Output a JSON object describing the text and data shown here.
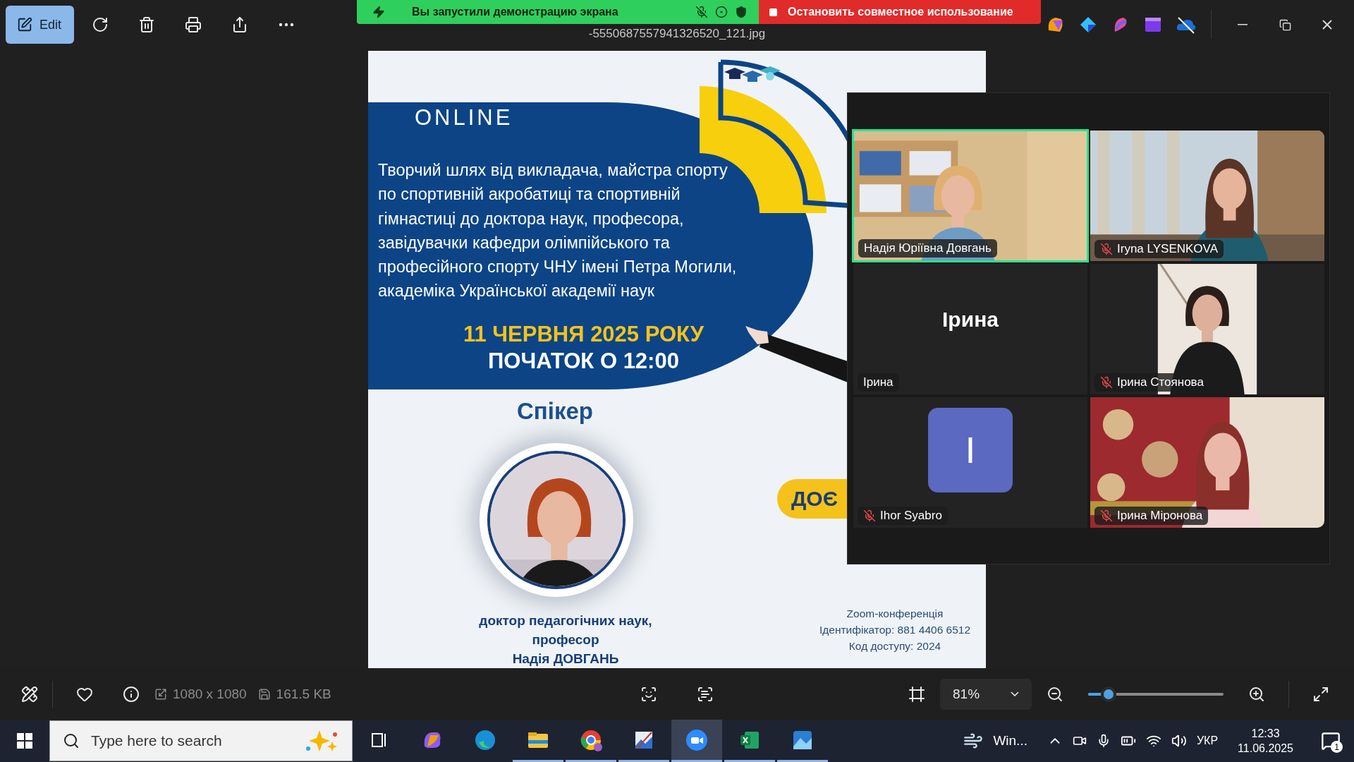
{
  "toolbar": {
    "edit_button": "Edit",
    "filename": "-5550687557941326520_121.jpg"
  },
  "share_banner": {
    "status": "Вы запустили демонстрацию экрана",
    "stop_button": "Остановить совместное использование"
  },
  "poster": {
    "badge": "ONLINE",
    "description": [
      "Творчий шлях від викладача, майстра спорту",
      "по спортивній акробатиці та спортивній",
      "гімнастиці до доктора наук, професора,",
      "завідувачки кафедри олімпійського та",
      "професійного спорту ЧНУ імені Петра Могили,",
      "академіка Української академії наук"
    ],
    "date": "11 ЧЕРВНЯ 2025 РОКУ",
    "start": "ПОЧАТОК О 12:00",
    "speaker_heading": "Спікер",
    "speaker_credentials": [
      "доктор педагогічних наук,",
      "професор",
      "Надія ДОВГАНЬ"
    ],
    "pill_text": "ДОЄ",
    "conference": [
      "Zoom-конференція",
      "Ідентифікатор: 881 4406 6512",
      "Код доступу: 2024"
    ]
  },
  "zoom_window": {
    "tiles": [
      {
        "kind": "video",
        "label": "Надія Юріївна Довгань",
        "muted": false,
        "speaking": true
      },
      {
        "kind": "video",
        "label": "Iryna LYSENKOVA",
        "muted": true,
        "speaking": false
      },
      {
        "kind": "name",
        "display": "Ірина",
        "label": "Ірина",
        "muted": false,
        "speaking": false
      },
      {
        "kind": "video",
        "label": "Ірина Стоянова",
        "muted": true,
        "speaking": false
      },
      {
        "kind": "avatar",
        "initial": "I",
        "label": "Ihor Syabro",
        "muted": true,
        "speaking": false
      },
      {
        "kind": "video",
        "label": "Ірина Міронова",
        "muted": true,
        "speaking": false
      }
    ]
  },
  "viewer_bar": {
    "dimensions": "1080 x 1080",
    "file_size": "161.5 KB",
    "zoom": "81%",
    "zoom_slider": {
      "level": 0.15
    }
  },
  "taskbar": {
    "search_placeholder": "Type here to search",
    "apps": [
      {
        "kind": "copilot",
        "selected": false,
        "running": false
      },
      {
        "kind": "edge",
        "selected": false,
        "running": false
      },
      {
        "kind": "explorer",
        "selected": false,
        "running": true
      },
      {
        "kind": "chrome",
        "selected": false,
        "running": true
      },
      {
        "kind": "paint",
        "selected": false,
        "running": true
      },
      {
        "kind": "zoom",
        "selected": true,
        "running": true
      },
      {
        "kind": "excel",
        "selected": false,
        "running": true
      },
      {
        "kind": "photos",
        "selected": false,
        "running": true
      }
    ],
    "weather": "Win...",
    "language": "УКР",
    "time": "12:33",
    "date": "11.06.2025",
    "notifications": "1"
  }
}
